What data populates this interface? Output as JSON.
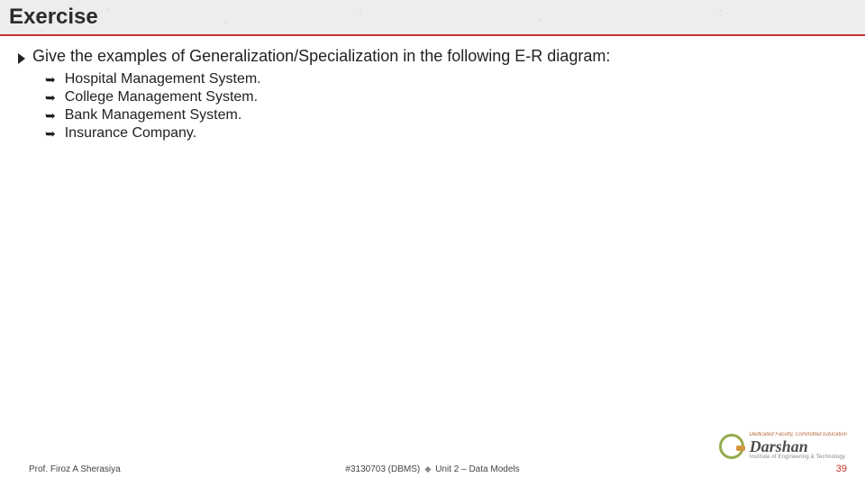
{
  "title": "Exercise",
  "main_point": "Give the examples of Generalization/Specialization in the following E-R diagram:",
  "sub_items": [
    "Hospital Management System.",
    "College Management System.",
    "Bank Management System.",
    "Insurance Company."
  ],
  "footer": {
    "professor": "Prof. Firoz A Sherasiya",
    "course_code": "#3130703 (DBMS)",
    "unit": "Unit 2 – Data Models",
    "page": "39"
  },
  "logo": {
    "name": "Darshan",
    "tagline": "Dedicated Faculty, Committed Education",
    "subtitle": "Institute of Engineering & Technology"
  }
}
